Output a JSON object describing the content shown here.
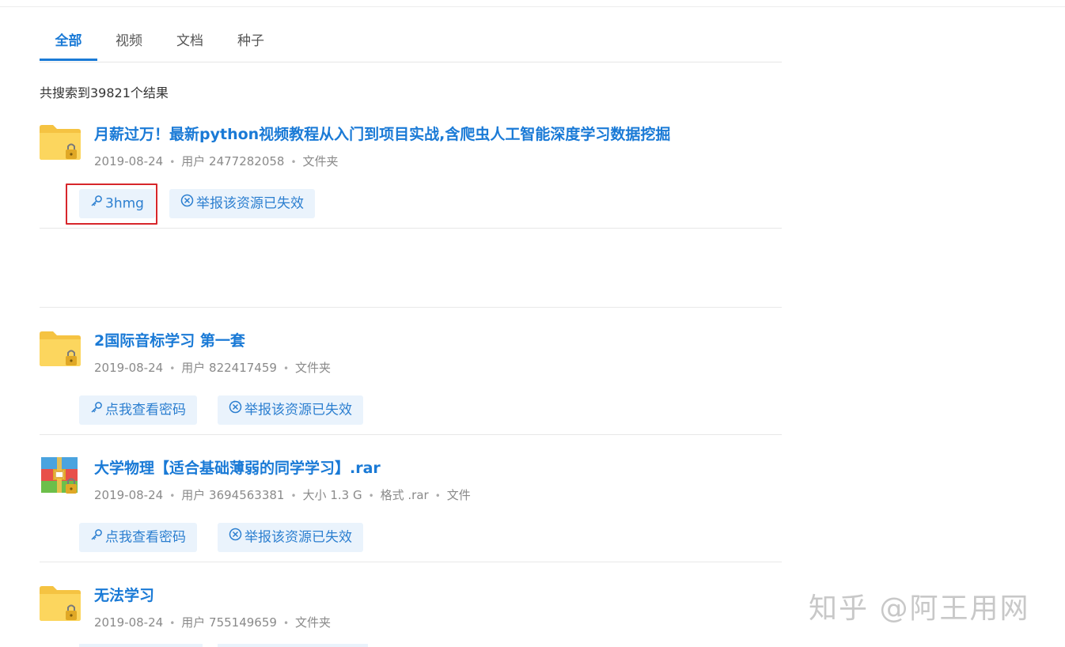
{
  "tabs": [
    {
      "label": "全部",
      "active": true
    },
    {
      "label": "视频",
      "active": false
    },
    {
      "label": "文档",
      "active": false
    },
    {
      "label": "种子",
      "active": false
    }
  ],
  "result_count": "共搜索到39821个结果",
  "results": [
    {
      "title": "月薪过万！最新python视频教程从入门到项目实战,含爬虫人工智能深度学习数据挖掘",
      "date": "2019-08-24",
      "user": "用户 2477282058",
      "type": "文件夹",
      "icon": "locked-folder-icon",
      "password_button": "3hmg",
      "report_button": "举报该资源已失效"
    },
    {
      "title": "2国际音标学习 第一套",
      "date": "2019-08-24",
      "user": "用户 822417459",
      "type": "文件夹",
      "icon": "locked-folder-icon",
      "password_button": "点我查看密码",
      "report_button": "举报该资源已失效"
    },
    {
      "title": "大学物理【适合基础薄弱的同学学习】.rar",
      "date": "2019-08-24",
      "user": "用户 3694563381",
      "size": "大小 1.3 G",
      "format": "格式 .rar",
      "type": "文件",
      "icon": "locked-archive-icon",
      "password_button": "点我查看密码",
      "report_button": "举报该资源已失效"
    },
    {
      "title": "无法学习",
      "date": "2019-08-24",
      "user": "用户 755149659",
      "type": "文件夹",
      "icon": "locked-folder-icon"
    }
  ],
  "watermark": "知乎 @阿王用网",
  "colors": {
    "accent": "#1a7ad6",
    "button_bg": "#eaf3fc",
    "highlight": "#d7262b",
    "folder": "#fcd45c"
  }
}
